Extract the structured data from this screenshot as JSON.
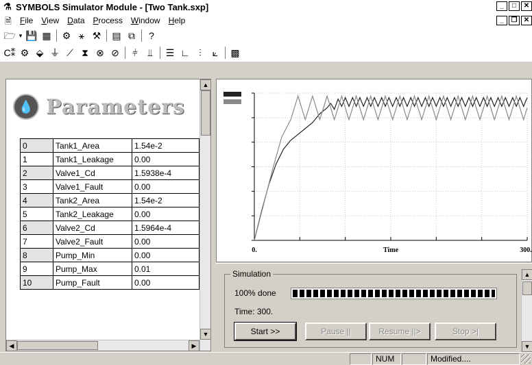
{
  "window": {
    "title": "SYMBOLS Simulator Module - [Two Tank.sxp]",
    "min_glyph": "_",
    "max_glyph": "□",
    "close_glyph": "✕",
    "restore_glyph": "❐"
  },
  "menu": {
    "items": [
      "File",
      "View",
      "Data",
      "Process",
      "Window",
      "Help"
    ],
    "mnemonics": [
      "F",
      "V",
      "D",
      "P",
      "W",
      "H"
    ]
  },
  "parameters": {
    "title": "Parameters",
    "rows": [
      {
        "index": "0",
        "name": "Tank1_Area",
        "value": "1.54e-2"
      },
      {
        "index": "1",
        "name": "Tank1_Leakage",
        "value": "0.00"
      },
      {
        "index": "2",
        "name": "Valve1_Cd",
        "value": "1.5938e-4"
      },
      {
        "index": "3",
        "name": "Valve1_Fault",
        "value": "0.00"
      },
      {
        "index": "4",
        "name": "Tank2_Area",
        "value": "1.54e-2"
      },
      {
        "index": "5",
        "name": "Tank2_Leakage",
        "value": "0.00"
      },
      {
        "index": "6",
        "name": "Valve2_Cd",
        "value": "1.5964e-4"
      },
      {
        "index": "7",
        "name": "Valve2_Fault",
        "value": "0.00"
      },
      {
        "index": "8",
        "name": "Pump_Min",
        "value": "0.00"
      },
      {
        "index": "9",
        "name": "Pump_Max",
        "value": "0.01"
      },
      {
        "index": "10",
        "name": "Pump_Fault",
        "value": "0.00"
      }
    ]
  },
  "chart_data": {
    "type": "line",
    "xlabel": "Time",
    "x_tick_labels": [
      "0.",
      "300."
    ],
    "xlim": [
      0,
      300
    ],
    "grid": true,
    "series": [
      {
        "color": "#222222",
        "points": [
          [
            0,
            0
          ],
          [
            8,
            20
          ],
          [
            16,
            38
          ],
          [
            24,
            52
          ],
          [
            32,
            62
          ],
          [
            40,
            68
          ],
          [
            48,
            72
          ],
          [
            56,
            76
          ],
          [
            64,
            80
          ],
          [
            72,
            86
          ],
          [
            80,
            90
          ],
          [
            84,
            93
          ],
          [
            88,
            89
          ],
          [
            92,
            96
          ],
          [
            96,
            91
          ],
          [
            100,
            97
          ],
          [
            104,
            91
          ],
          [
            108,
            97
          ],
          [
            112,
            91
          ],
          [
            116,
            97
          ],
          [
            120,
            91
          ],
          [
            124,
            97
          ],
          [
            128,
            91
          ],
          [
            132,
            97
          ],
          [
            136,
            91
          ],
          [
            140,
            97
          ],
          [
            144,
            91
          ],
          [
            148,
            97
          ],
          [
            152,
            91
          ],
          [
            156,
            97
          ],
          [
            160,
            91
          ],
          [
            164,
            97
          ],
          [
            168,
            91
          ],
          [
            172,
            97
          ],
          [
            176,
            91
          ],
          [
            180,
            97
          ],
          [
            184,
            91
          ],
          [
            188,
            97
          ],
          [
            192,
            91
          ],
          [
            196,
            97
          ],
          [
            200,
            91
          ],
          [
            204,
            97
          ],
          [
            208,
            91
          ],
          [
            212,
            97
          ],
          [
            216,
            91
          ],
          [
            220,
            97
          ],
          [
            224,
            91
          ],
          [
            228,
            97
          ],
          [
            232,
            91
          ],
          [
            236,
            97
          ],
          [
            240,
            91
          ],
          [
            244,
            97
          ],
          [
            248,
            91
          ],
          [
            252,
            97
          ],
          [
            256,
            91
          ],
          [
            260,
            97
          ],
          [
            264,
            91
          ],
          [
            268,
            97
          ],
          [
            272,
            91
          ],
          [
            276,
            97
          ],
          [
            280,
            91
          ],
          [
            284,
            97
          ],
          [
            288,
            91
          ],
          [
            292,
            97
          ],
          [
            296,
            91
          ],
          [
            300,
            97
          ]
        ]
      },
      {
        "color": "#8a8a8a",
        "points": [
          [
            0,
            0
          ],
          [
            10,
            24
          ],
          [
            20,
            48
          ],
          [
            30,
            70
          ],
          [
            40,
            82
          ],
          [
            48,
            98
          ],
          [
            56,
            82
          ],
          [
            64,
            98
          ],
          [
            72,
            82
          ],
          [
            80,
            98
          ],
          [
            88,
            82
          ],
          [
            96,
            98
          ],
          [
            104,
            82
          ],
          [
            112,
            98
          ],
          [
            120,
            82
          ],
          [
            128,
            98
          ],
          [
            136,
            82
          ],
          [
            144,
            98
          ],
          [
            152,
            82
          ],
          [
            160,
            98
          ],
          [
            168,
            82
          ],
          [
            176,
            98
          ],
          [
            184,
            82
          ],
          [
            192,
            98
          ],
          [
            200,
            82
          ],
          [
            208,
            98
          ],
          [
            216,
            82
          ],
          [
            224,
            98
          ],
          [
            232,
            82
          ],
          [
            240,
            98
          ],
          [
            248,
            82
          ],
          [
            256,
            98
          ],
          [
            264,
            82
          ],
          [
            272,
            98
          ],
          [
            280,
            82
          ],
          [
            288,
            98
          ],
          [
            296,
            82
          ],
          [
            300,
            90
          ]
        ]
      }
    ]
  },
  "simulation": {
    "group_label": "Simulation",
    "progress_label": "100% done",
    "progress": 1.0,
    "time_label": "Time: 300.",
    "start_label": "Start >>",
    "pause_label": "Pause ||",
    "resume_label": "Resume ||>",
    "stop_label": "Stop >|"
  },
  "status": {
    "num": "NUM",
    "modified": "Modified...."
  },
  "colors": {
    "face": "#d4d0c8",
    "series1": "#222222",
    "series2": "#8a8a8a"
  }
}
